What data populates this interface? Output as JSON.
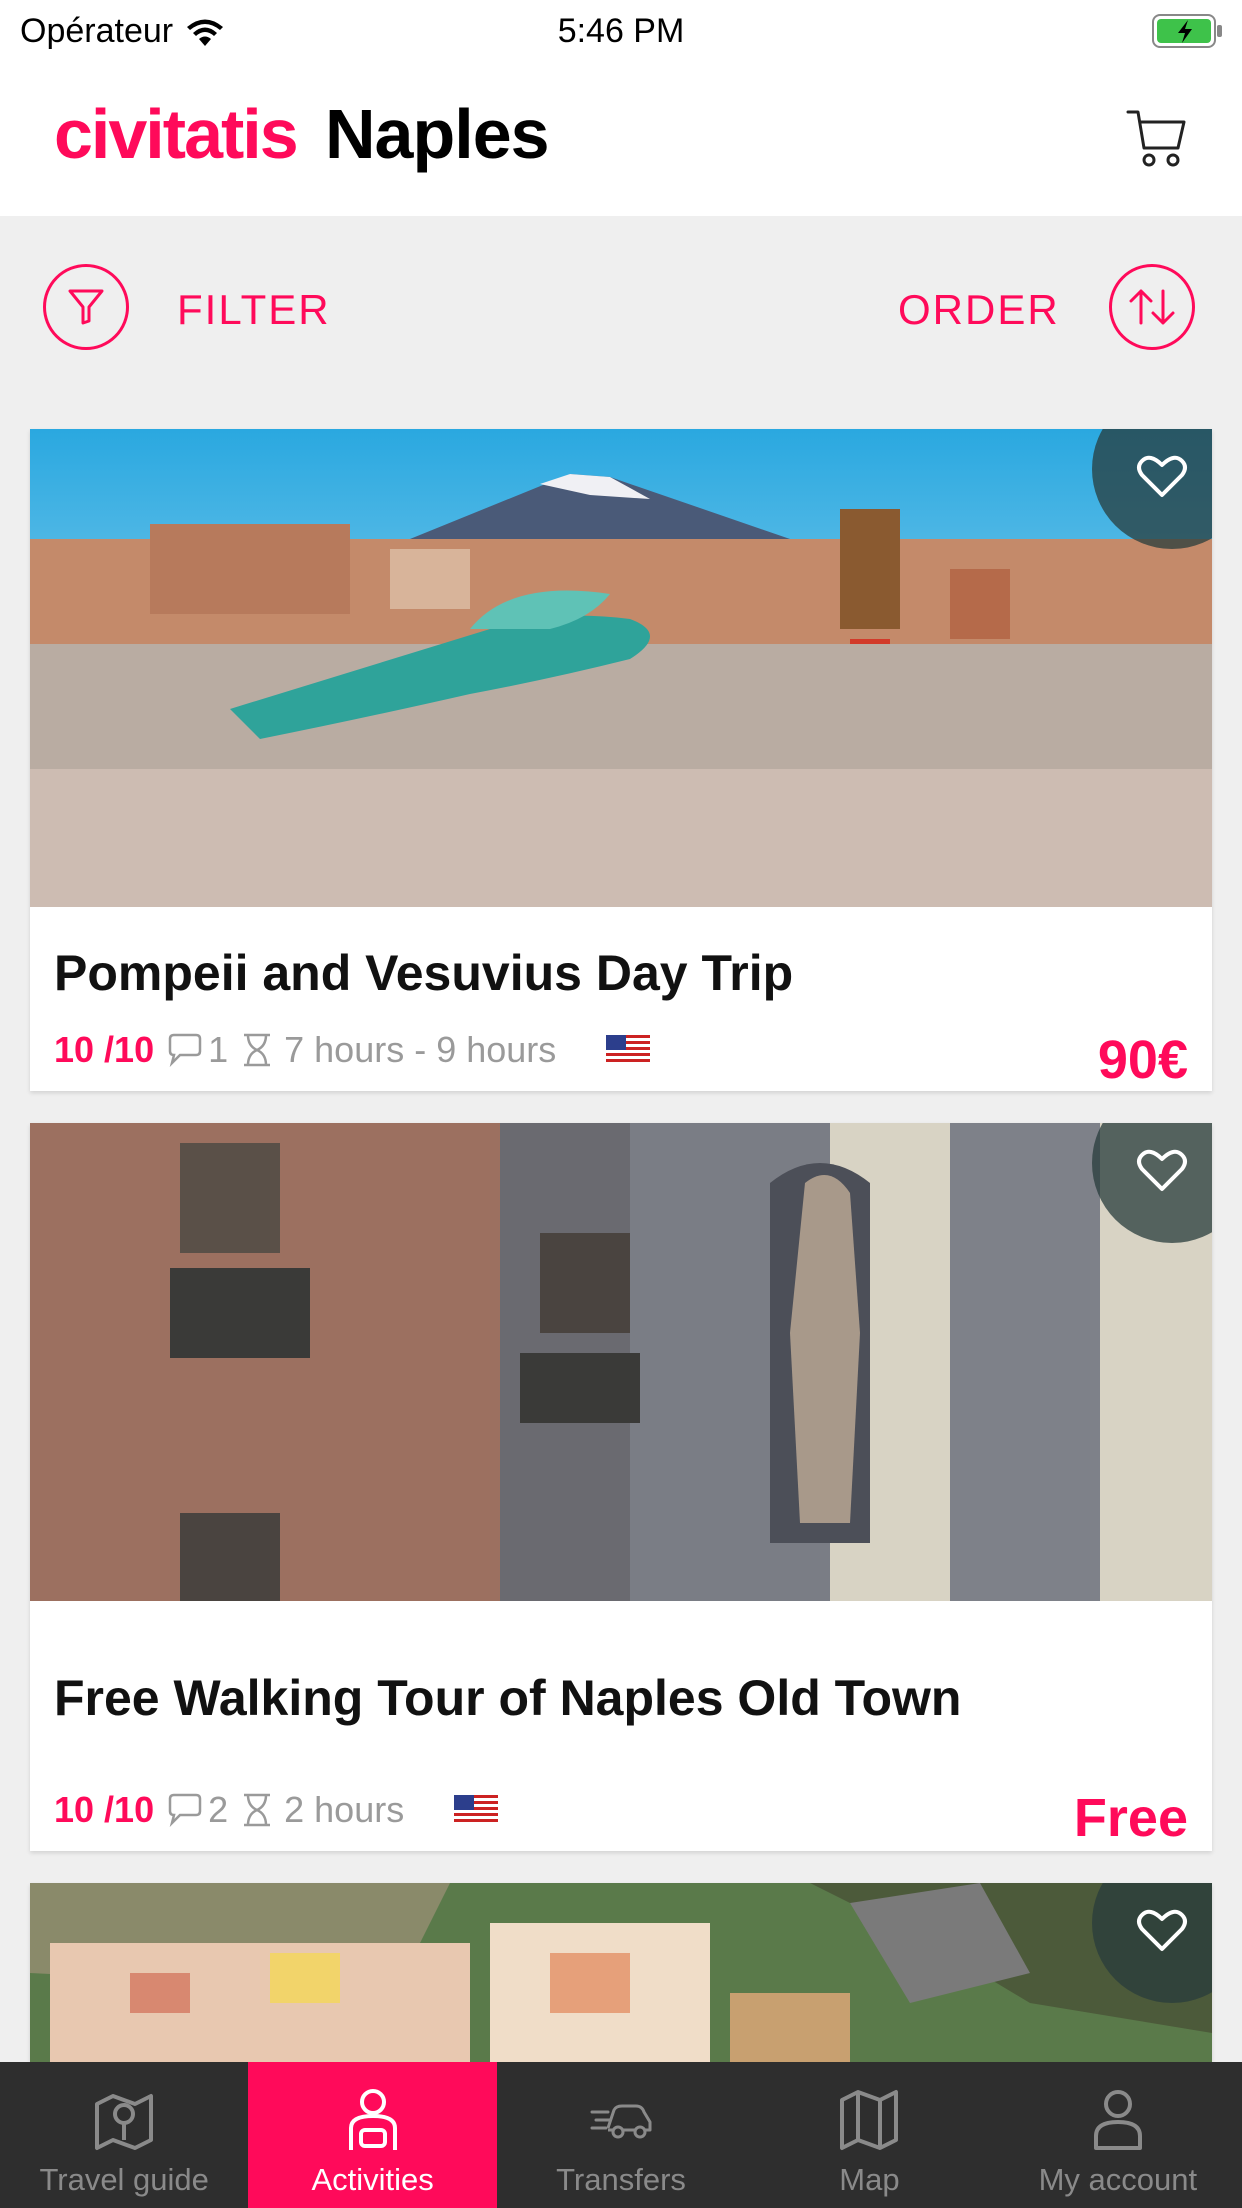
{
  "status": {
    "carrier": "Opérateur",
    "time": "5:46 PM"
  },
  "header": {
    "brand": "civitatis",
    "city": "Naples"
  },
  "toolbar": {
    "filter_label": "FILTER",
    "order_label": "ORDER"
  },
  "cards": [
    {
      "title": "Pompeii and Vesuvius Day Trip",
      "rating": "10 /10",
      "comments": "1",
      "duration": "7 hours - 9 hours",
      "price": "90€",
      "language_flag": "us-flag"
    },
    {
      "title": "Free Walking Tour of Naples Old Town",
      "rating": "10 /10",
      "comments": "2",
      "duration": "2 hours",
      "price": "Free",
      "language_flag": "us-flag"
    }
  ],
  "tabs": [
    {
      "label": "Travel guide",
      "icon": "map-pin-icon"
    },
    {
      "label": "Activities",
      "icon": "activities-icon",
      "active": true
    },
    {
      "label": "Transfers",
      "icon": "car-icon"
    },
    {
      "label": "Map",
      "icon": "map-icon"
    },
    {
      "label": "My account",
      "icon": "user-icon"
    }
  ],
  "colors": {
    "accent": "#ff0a5a",
    "tabbar": "#2e2e2e"
  }
}
